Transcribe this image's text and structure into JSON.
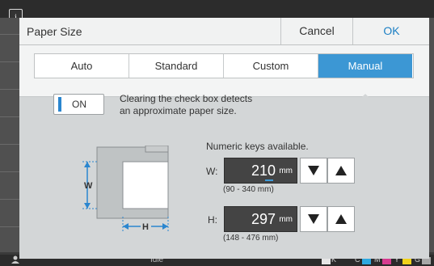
{
  "background": {
    "status_text": "Idle",
    "ink_labels": [
      "K",
      "C",
      "M",
      "Y",
      "G"
    ],
    "ink_colors": [
      "#e6e6e6",
      "#2fa9e0",
      "#d63b8f",
      "#f1d21b",
      "#a8a8a8"
    ]
  },
  "dialog": {
    "title": "Paper Size",
    "cancel_label": "Cancel",
    "ok_label": "OK",
    "tabs": [
      {
        "label": "Auto",
        "active": false
      },
      {
        "label": "Standard",
        "active": false
      },
      {
        "label": "Custom",
        "active": false
      },
      {
        "label": "Manual",
        "active": true
      }
    ],
    "toggle_label": "ON",
    "hint_line1": "Clearing the check box detects",
    "hint_line2": "an approximate paper size.",
    "diagram": {
      "w_label": "W",
      "h_label": "H"
    },
    "numeric_note": "Numeric keys available.",
    "width": {
      "label": "W:",
      "value": "210",
      "unit": "mm",
      "range": "(90 - 340 mm)"
    },
    "height": {
      "label": "H:",
      "value": "297",
      "unit": "mm",
      "range": "(148 - 476 mm)"
    },
    "accent_color": "#3c97d4"
  }
}
